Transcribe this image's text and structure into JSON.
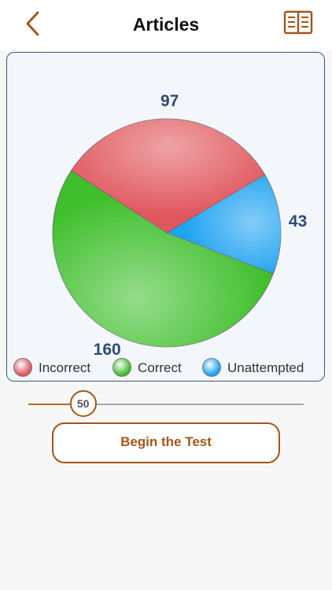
{
  "header": {
    "title": "Articles",
    "back_icon": "chevron-left-icon",
    "book_icon": "book-open-icon",
    "accent": "#a3561a"
  },
  "chart_data": {
    "type": "pie",
    "slices": [
      {
        "name": "Incorrect",
        "value": 97,
        "label": "97",
        "color": "#e0585e"
      },
      {
        "name": "Unattempted",
        "value": 43,
        "label": "43",
        "color": "#1ea3f1"
      },
      {
        "name": "Correct",
        "value": 160,
        "label": "160",
        "color": "#3fbf2c"
      }
    ],
    "legend_placement": "bottom"
  },
  "legend": [
    {
      "label": "Incorrect",
      "color": "#e0585e"
    },
    {
      "label": "Correct",
      "color": "#3fbf2c"
    },
    {
      "label": "Unattempted",
      "color": "#1ea3f1"
    }
  ],
  "slider": {
    "value": 50,
    "min": 0,
    "max": 300,
    "label": "50"
  },
  "begin_button": {
    "label": "Begin the Test"
  }
}
